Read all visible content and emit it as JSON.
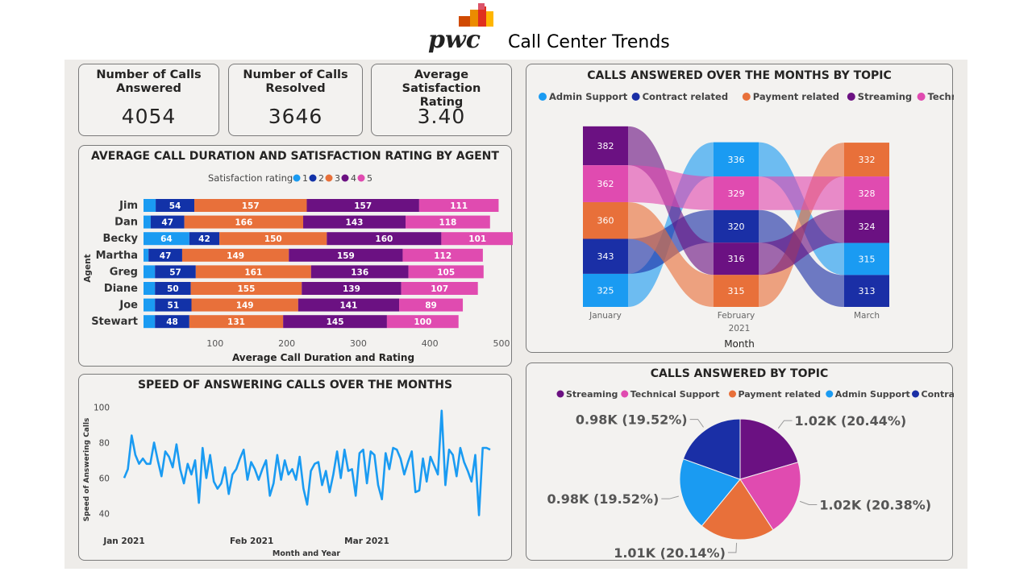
{
  "header": {
    "logo_text": "pwc",
    "title": "Call Center Trends"
  },
  "kpis": [
    {
      "label": "Number of Calls Answered",
      "value": "4054"
    },
    {
      "label": "Number of Calls Resolved",
      "value": "3646"
    },
    {
      "label": "Average Satisfaction Rating",
      "value": "3.40"
    }
  ],
  "colors": {
    "r1": "#1a9bf2",
    "r2": "#1232a8",
    "r3": "#e8703a",
    "r4": "#6b1182",
    "r5": "#e04bb0",
    "admin": "#1a9bf2",
    "contract": "#1a2fa6",
    "payment": "#e8703a",
    "streaming": "#6b1182",
    "technical": "#e04bb0"
  },
  "agent_chart": {
    "title": "AVERAGE CALL DURATION AND SATISFACTION RATING BY AGENT",
    "legend_title": "Satisfaction rating",
    "legend_items": [
      "1",
      "2",
      "3",
      "4",
      "5"
    ],
    "y_axis_label": "Agent",
    "x_axis_label": "Average Call Duration and Rating",
    "x_ticks": [
      "100",
      "200",
      "300",
      "400",
      "500"
    ]
  },
  "speed_chart": {
    "title": "SPEED OF ANSWERING CALLS OVER THE MONTHS",
    "y_axis_label": "Speed of Answering Calls",
    "x_axis_label": "Month and Year",
    "y_ticks": [
      "40",
      "60",
      "80",
      "100"
    ],
    "x_ticks": [
      "Jan 2021",
      "Feb 2021",
      "Mar 2021"
    ]
  },
  "ribbon_chart": {
    "title": "CALLS ANSWERED OVER THE MONTHS BY TOPIC",
    "legend": [
      "Admin Support",
      "Contract related",
      "Payment related",
      "Streaming",
      "Technical Support"
    ],
    "x_axis_label": "Month",
    "year_label": "2021",
    "months": [
      "January",
      "February",
      "March"
    ]
  },
  "pie_chart": {
    "title": "CALLS ANSWERED BY TOPIC",
    "legend": [
      "Streaming",
      "Technical Support",
      "Payment related",
      "Admin Support",
      "Contract related"
    ],
    "labels": [
      "1.02K (20.44%)",
      "1.02K (20.38%)",
      "1.01K (20.14%)",
      "0.98K (19.52%)",
      "0.98K (19.52%)"
    ]
  },
  "chart_data": [
    {
      "type": "bar",
      "stacked": true,
      "orientation": "horizontal",
      "title": "AVERAGE CALL DURATION AND SATISFACTION RATING BY AGENT",
      "xlabel": "Average Call Duration and Rating",
      "ylabel": "Agent",
      "xlim": [
        0,
        550
      ],
      "categories": [
        "Jim",
        "Dan",
        "Becky",
        "Martha",
        "Greg",
        "Diane",
        "Joe",
        "Stewart"
      ],
      "series": [
        {
          "name": "1",
          "values": [
            17,
            10,
            64,
            7,
            16,
            16,
            16,
            16
          ]
        },
        {
          "name": "2",
          "values": [
            54,
            47,
            42,
            47,
            57,
            50,
            51,
            48
          ]
        },
        {
          "name": "3",
          "values": [
            157,
            166,
            150,
            149,
            161,
            155,
            149,
            131
          ]
        },
        {
          "name": "4",
          "values": [
            157,
            143,
            160,
            159,
            136,
            139,
            141,
            145
          ]
        },
        {
          "name": "5",
          "values": [
            111,
            118,
            101,
            112,
            105,
            107,
            89,
            100
          ]
        }
      ],
      "shown_labels": [
        [
          false,
          false,
          true,
          false,
          false,
          false,
          false,
          false
        ],
        [
          true,
          true,
          true,
          true,
          true,
          true,
          true,
          true
        ],
        [
          true,
          true,
          true,
          true,
          true,
          true,
          true,
          true
        ],
        [
          true,
          true,
          true,
          true,
          true,
          true,
          true,
          true
        ],
        [
          true,
          true,
          true,
          true,
          true,
          true,
          true,
          true
        ]
      ],
      "legend_position": "top"
    },
    {
      "type": "line",
      "title": "SPEED OF ANSWERING CALLS OVER THE MONTHS",
      "xlabel": "Month and Year",
      "ylabel": "Speed of Answering Calls",
      "x_start": "2021-01-01",
      "x_end": "2021-03-31",
      "ylim": [
        32,
        102
      ],
      "values": [
        60,
        65,
        84,
        73,
        68,
        71,
        68,
        68,
        80,
        70,
        61,
        75,
        72,
        66,
        79,
        65,
        57,
        68,
        62,
        70,
        46,
        77,
        60,
        73,
        58,
        54,
        57,
        66,
        51,
        62,
        65,
        71,
        76,
        59,
        69,
        65,
        59,
        65,
        70,
        50,
        57,
        73,
        59,
        70,
        62,
        65,
        59,
        72,
        54,
        45,
        64,
        68,
        69,
        56,
        64,
        52,
        62,
        75,
        60,
        76,
        64,
        65,
        50,
        74,
        76,
        57,
        75,
        73,
        56,
        48,
        74,
        65,
        77,
        76,
        71,
        62,
        69,
        75,
        52,
        53,
        71,
        58,
        72,
        67,
        62,
        98,
        56,
        76,
        73,
        61,
        77,
        69,
        64,
        58,
        73,
        39,
        77,
        77,
        76
      ],
      "grid": false
    },
    {
      "type": "area",
      "subtype": "ribbon",
      "title": "CALLS ANSWERED OVER THE MONTHS BY TOPIC",
      "xlabel": "Month",
      "categories": [
        "January",
        "February",
        "March"
      ],
      "series": [
        {
          "name": "Admin Support",
          "values": [
            325,
            336,
            315
          ]
        },
        {
          "name": "Contract related",
          "values": [
            343,
            320,
            313
          ]
        },
        {
          "name": "Payment related",
          "values": [
            360,
            315,
            332
          ]
        },
        {
          "name": "Streaming",
          "values": [
            382,
            316,
            324
          ]
        },
        {
          "name": "Technical Support",
          "values": [
            362,
            329,
            328
          ]
        }
      ],
      "legend_position": "top"
    },
    {
      "type": "pie",
      "title": "CALLS ANSWERED BY TOPIC",
      "categories": [
        "Streaming",
        "Technical Support",
        "Payment related",
        "Admin Support",
        "Contract related"
      ],
      "values": [
        1020,
        1020,
        1010,
        980,
        980
      ],
      "percentages": [
        20.44,
        20.38,
        20.14,
        19.52,
        19.52
      ],
      "legend_position": "top"
    }
  ]
}
